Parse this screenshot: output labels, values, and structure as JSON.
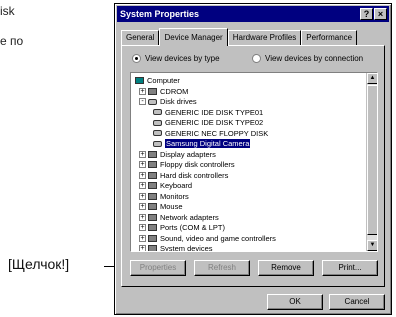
{
  "side_text": [
    "isk",
    "e по"
  ],
  "callout": {
    "label": "[Щелчок!]"
  },
  "window": {
    "title": "System Properties",
    "help_button": "?",
    "close_button": "×",
    "tabs": [
      "General",
      "Device Manager",
      "Hardware Profiles",
      "Performance"
    ],
    "active_tab": "Device Manager",
    "view_options": [
      {
        "label": "View devices by type",
        "selected": true
      },
      {
        "label": "View devices by connection",
        "selected": false
      }
    ],
    "tree": [
      {
        "label": "Computer",
        "icon": "computer-icon",
        "depth": 0,
        "expander": ""
      },
      {
        "label": "CDROM",
        "icon": "cdrom-icon",
        "depth": 1,
        "expander": "+"
      },
      {
        "label": "Disk drives",
        "icon": "disk-drive-icon",
        "depth": 1,
        "expander": "-"
      },
      {
        "label": "GENERIC IDE  DISK TYPE01",
        "icon": "disk-drive-icon",
        "depth": 2,
        "expander": ""
      },
      {
        "label": "GENERIC IDE  DISK TYPE02",
        "icon": "disk-drive-icon",
        "depth": 2,
        "expander": ""
      },
      {
        "label": "GENERIC NEC  FLOPPY DISK",
        "icon": "disk-drive-icon",
        "depth": 2,
        "expander": ""
      },
      {
        "label": "Samsung Digital Camera",
        "icon": "disk-drive-icon",
        "depth": 2,
        "expander": "",
        "selected": true
      },
      {
        "label": "Display adapters",
        "icon": "display-icon",
        "depth": 1,
        "expander": "+"
      },
      {
        "label": "Floppy disk controllers",
        "icon": "floppy-controller-icon",
        "depth": 1,
        "expander": "+"
      },
      {
        "label": "Hard disk controllers",
        "icon": "hdd-controller-icon",
        "depth": 1,
        "expander": "+"
      },
      {
        "label": "Keyboard",
        "icon": "keyboard-icon",
        "depth": 1,
        "expander": "+"
      },
      {
        "label": "Monitors",
        "icon": "monitor-icon",
        "depth": 1,
        "expander": "+"
      },
      {
        "label": "Mouse",
        "icon": "mouse-icon",
        "depth": 1,
        "expander": "+"
      },
      {
        "label": "Network adapters",
        "icon": "network-icon",
        "depth": 1,
        "expander": "+"
      },
      {
        "label": "Ports (COM & LPT)",
        "icon": "ports-icon",
        "depth": 1,
        "expander": "+"
      },
      {
        "label": "Sound, video and game controllers",
        "icon": "sound-icon",
        "depth": 1,
        "expander": "+"
      },
      {
        "label": "System devices",
        "icon": "system-icon",
        "depth": 1,
        "expander": "+"
      }
    ],
    "buttons": {
      "properties": "Properties",
      "refresh": "Refresh",
      "remove": "Remove",
      "print": "Print..."
    },
    "ok": "OK",
    "cancel": "Cancel"
  }
}
